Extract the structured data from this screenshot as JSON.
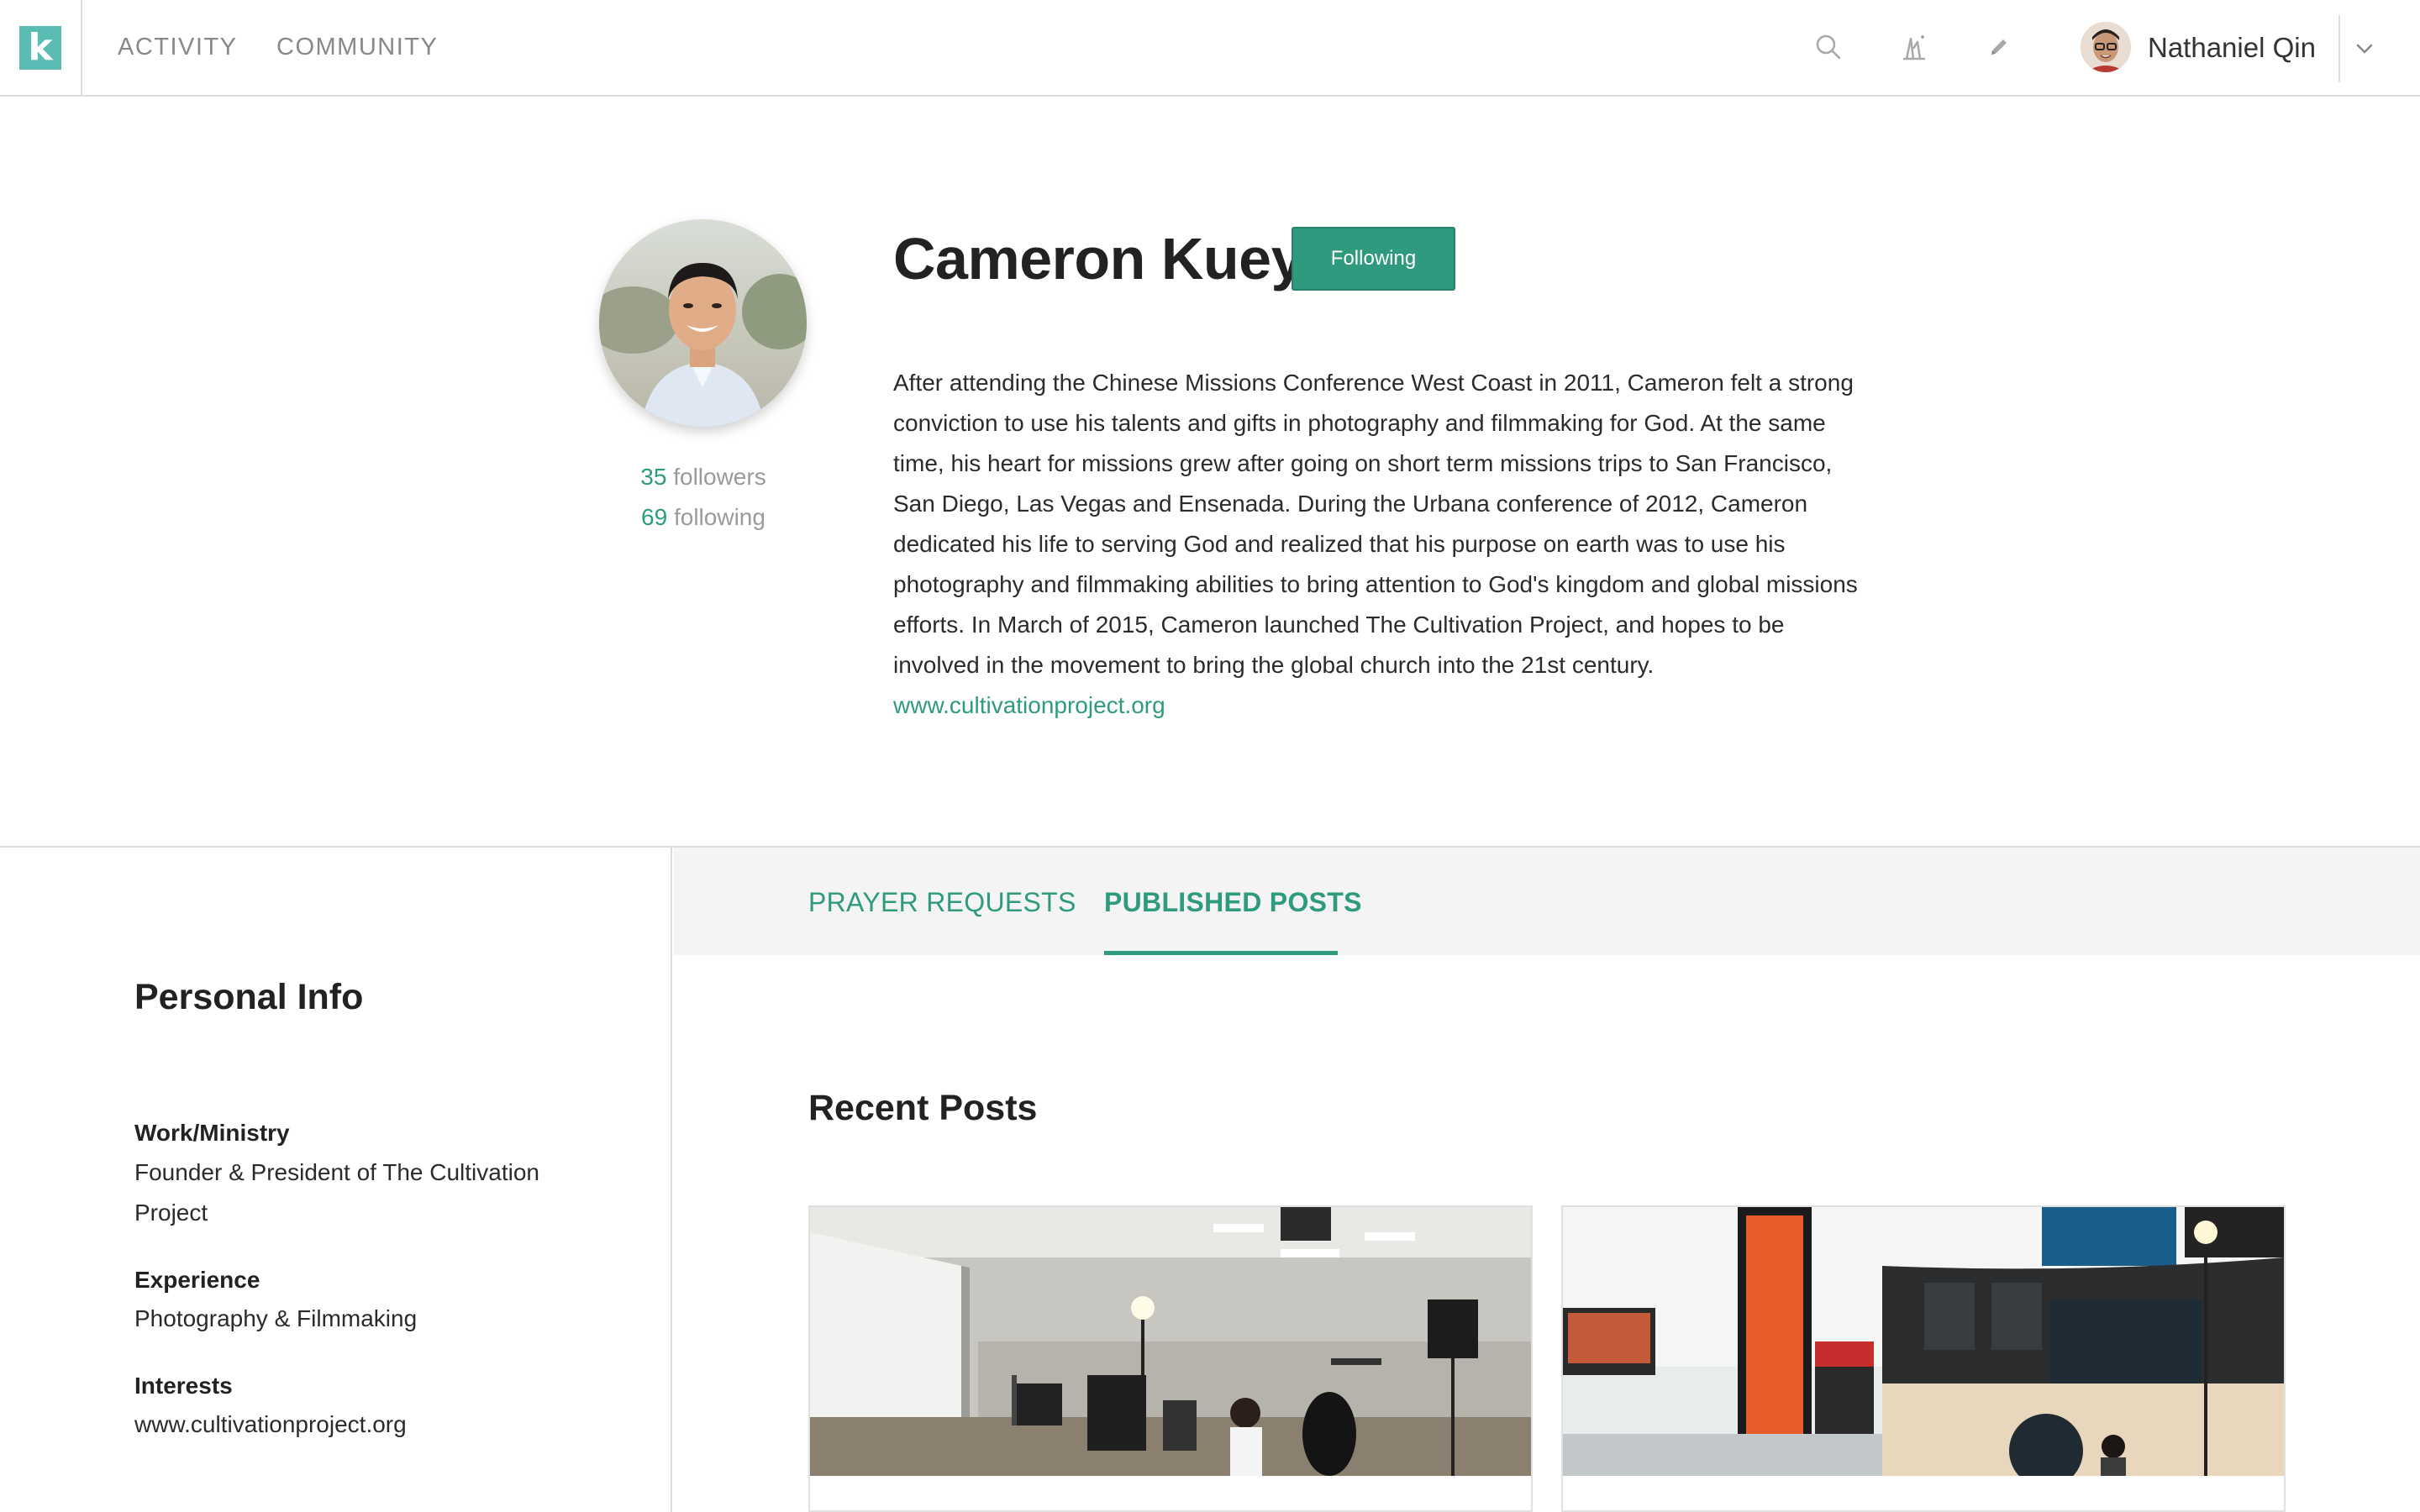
{
  "nav": {
    "logo_letter": "k",
    "activity": "ACTIVITY",
    "community": "COMMUNITY",
    "icons": [
      "search-icon",
      "insights-icon",
      "pencil-icon"
    ]
  },
  "user": {
    "name": "Nathaniel Qin"
  },
  "profile": {
    "name": "Cameron Kuey",
    "follow_button": "Following",
    "followers_count": "35",
    "followers_label": "followers",
    "following_count": "69",
    "following_label": "following",
    "bio": "After attending the Chinese Missions Conference West Coast in 2011, Cameron felt a strong conviction to use his talents and gifts in photography and filmmaking for God. At the same time, his heart for missions grew after going on short term missions trips to San Francisco, San Diego, Las Vegas and Ensenada. During the Urbana conference of 2012, Cameron dedicated his life to serving God and realized that his purpose on earth was to use his photography and filmmaking abilities to bring attention to God's kingdom and global missions efforts. In March of 2015, Cameron launched The Cultivation Project, and hopes to be involved in the movement to bring the global church into the 21st century.",
    "bio_link": "www.cultivationproject.org"
  },
  "personal_info": {
    "title": "Personal Info",
    "work_label": "Work/Ministry",
    "work_value": "Founder & President of The Cultivation Project",
    "experience_label": "Experience",
    "experience_value": "Photography & Filmmaking",
    "interests_label": "Interests",
    "interests_value": "www.cultivationproject.org"
  },
  "tabs": {
    "prayer": "PRAYER REQUESTS",
    "posts": "PUBLISHED POSTS",
    "active": "PUBLISHED POSTS"
  },
  "recent": {
    "title": "Recent Posts"
  },
  "colors": {
    "accent": "#2e9a7e",
    "logo": "#5bbcb4",
    "border": "#dcdcdc",
    "tabbar_bg": "#f4f4f4"
  }
}
